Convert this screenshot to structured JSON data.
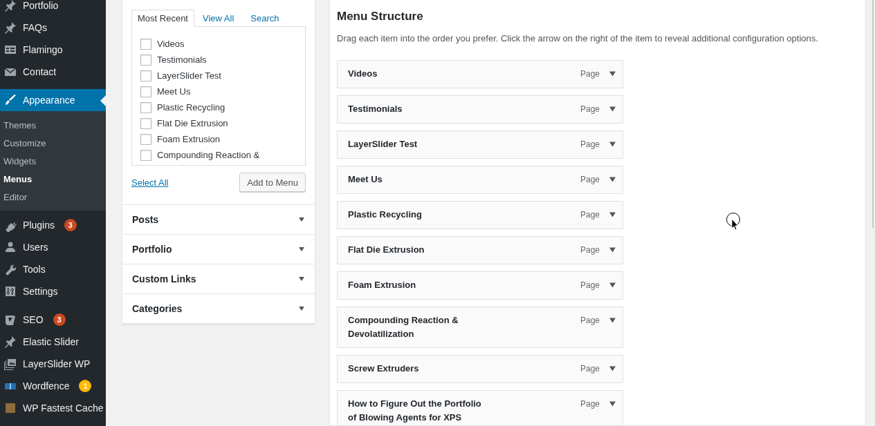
{
  "sidebar": {
    "items": [
      {
        "label": "Portfolio",
        "selected": false
      },
      {
        "label": "FAQs",
        "selected": false
      },
      {
        "label": "Flamingo",
        "selected": false
      },
      {
        "label": "Contact",
        "selected": false
      },
      {
        "label": "Appearance",
        "selected": true,
        "expanded": true,
        "children": [
          {
            "label": "Themes",
            "selected": false
          },
          {
            "label": "Customize",
            "selected": false
          },
          {
            "label": "Widgets",
            "selected": false
          },
          {
            "label": "Menus",
            "selected": true
          },
          {
            "label": "Editor",
            "selected": false
          }
        ]
      },
      {
        "label": "Plugins",
        "selected": false,
        "badge": "3",
        "color": "#ca4a1f"
      },
      {
        "label": "Users",
        "selected": false
      },
      {
        "label": "Tools",
        "selected": false
      },
      {
        "label": "Settings",
        "selected": false
      },
      {
        "label": "SEO",
        "selected": false,
        "badge": "3",
        "color": "#ca4a1f"
      },
      {
        "label": "Elastic Slider",
        "selected": false
      },
      {
        "label": "LayerSlider WP",
        "selected": false
      },
      {
        "label": "Wordfence",
        "selected": false,
        "badge": "1",
        "color": "#ffb900"
      },
      {
        "label": "WP Fastest Cache",
        "selected": false
      }
    ]
  },
  "add_items": {
    "tabs": [
      {
        "label": "Most Recent",
        "selected": true
      },
      {
        "label": "View All",
        "selected": false
      },
      {
        "label": "Search",
        "selected": false
      }
    ],
    "pages": [
      {
        "label": "Videos",
        "checked": false
      },
      {
        "label": "Testimonials",
        "checked": false
      },
      {
        "label": "LayerSlider Test",
        "checked": false
      },
      {
        "label": "Meet Us",
        "checked": false
      },
      {
        "label": "Plastic Recycling",
        "checked": false
      },
      {
        "label": "Flat Die Extrusion",
        "checked": false
      },
      {
        "label": "Foam Extrusion",
        "checked": false
      },
      {
        "label": "Compounding Reaction &",
        "checked": false
      }
    ],
    "select_all": "Select All",
    "add_button": "Add to Menu",
    "sections": [
      {
        "title": "Posts",
        "expanded": false
      },
      {
        "title": "Portfolio",
        "expanded": false
      },
      {
        "title": "Custom Links",
        "expanded": false
      },
      {
        "title": "Categories",
        "expanded": false
      }
    ]
  },
  "menu_structure": {
    "title": "Menu Structure",
    "description": "Drag each item into the order you prefer. Click the arrow on the right of the item to reveal additional configuration options.",
    "items": [
      {
        "title": "Videos",
        "type": "Page"
      },
      {
        "title": "Testimonials",
        "type": "Page"
      },
      {
        "title": "LayerSlider Test",
        "type": "Page"
      },
      {
        "title": "Meet Us",
        "type": "Page"
      },
      {
        "title": "Plastic Recycling",
        "type": "Page"
      },
      {
        "title": "Flat Die Extrusion",
        "type": "Page"
      },
      {
        "title": "Foam Extrusion",
        "type": "Page"
      },
      {
        "title": "Compounding Reaction & Devolatilization",
        "type": "Page"
      },
      {
        "title": "Screw Extruders",
        "type": "Page"
      },
      {
        "title": "How to Figure Out the Portfolio of Blowing Agents for XPS",
        "type": "Page"
      }
    ]
  }
}
